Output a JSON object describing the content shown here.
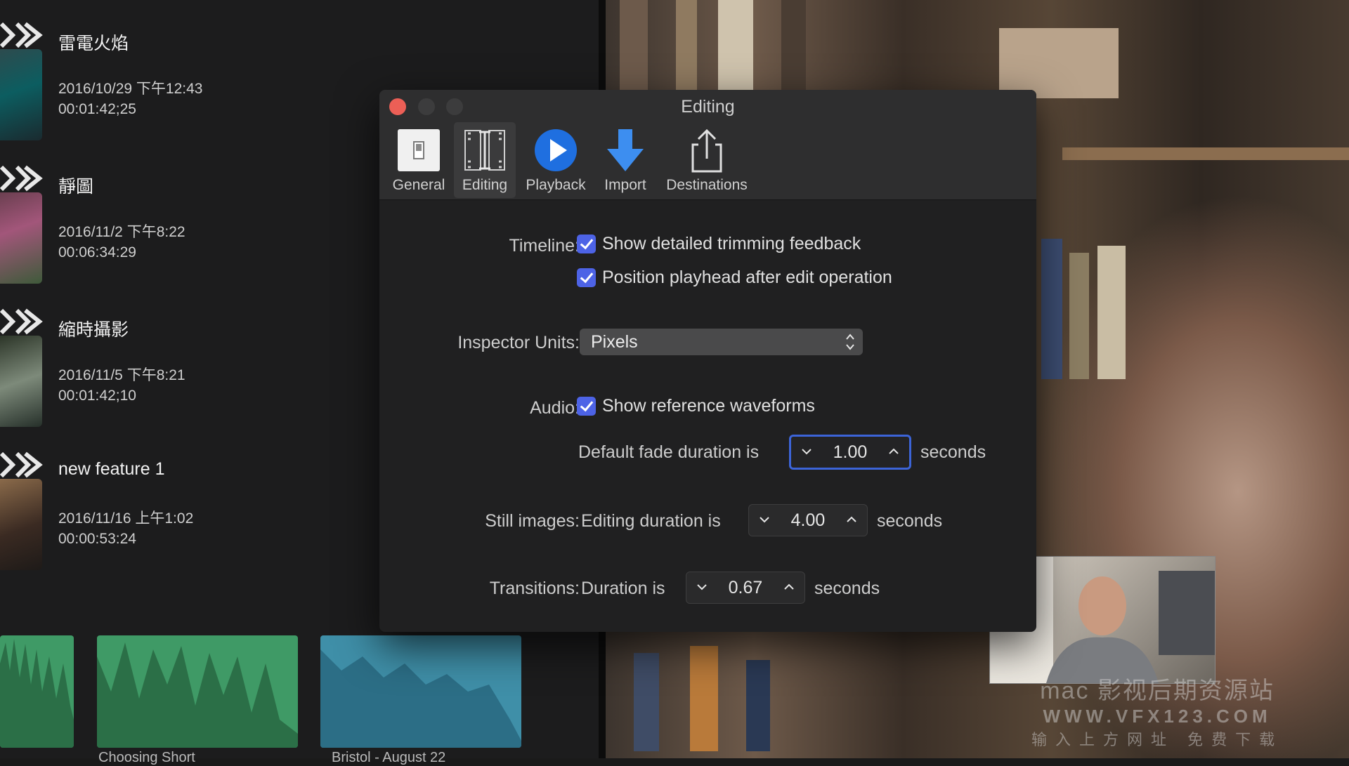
{
  "library": {
    "items": [
      {
        "name": "雷電火焰",
        "date": "2016/10/29 下午12:43",
        "duration": "00:01:42;25"
      },
      {
        "name": "靜圖",
        "date": "2016/11/2 下午8:22",
        "duration": "00:06:34:29"
      },
      {
        "name": "縮時攝影",
        "date": "2016/11/5 下午8:21",
        "duration": "00:01:42;10"
      },
      {
        "name": "new feature 1",
        "date": "2016/11/16 上午1:02",
        "duration": "00:00:53:24"
      }
    ],
    "waveforms": [
      "",
      "Choosing Short",
      "Bristol - August 22"
    ]
  },
  "window": {
    "title": "Editing",
    "tabs": [
      {
        "label": "General",
        "icon": "switch-icon"
      },
      {
        "label": "Editing",
        "icon": "film-trim-icon"
      },
      {
        "label": "Playback",
        "icon": "play-icon"
      },
      {
        "label": "Import",
        "icon": "down-arrow-icon"
      },
      {
        "label": "Destinations",
        "icon": "share-icon"
      }
    ],
    "active_tab": "Editing"
  },
  "prefs": {
    "timeline_label": "Timeline:",
    "timeline_opt1": "Show detailed trimming feedback",
    "timeline_opt2": "Position playhead after edit operation",
    "inspector_label": "Inspector Units:",
    "inspector_value": "Pixels",
    "audio_label": "Audio:",
    "audio_opt1": "Show reference waveforms",
    "fade_prefix": "Default fade duration is",
    "fade_value": "1.00",
    "seconds": "seconds",
    "still_label": "Still images:",
    "still_prefix": "Editing duration is",
    "still_value": "4.00",
    "transitions_label": "Transitions:",
    "transitions_prefix": "Duration is",
    "transitions_value": "0.67"
  },
  "watermark": {
    "line1": "mac 影视后期资源站",
    "line2": "WWW.VFX123.COM",
    "line3": "输入上方网址 免费下载"
  },
  "colors": {
    "checkbox": "#4d63e6",
    "close_button": "#ec5f56",
    "focus_ring": "#3c64d8",
    "play_icon": "#1f6fe0",
    "import_icon": "#3d8ef0"
  }
}
